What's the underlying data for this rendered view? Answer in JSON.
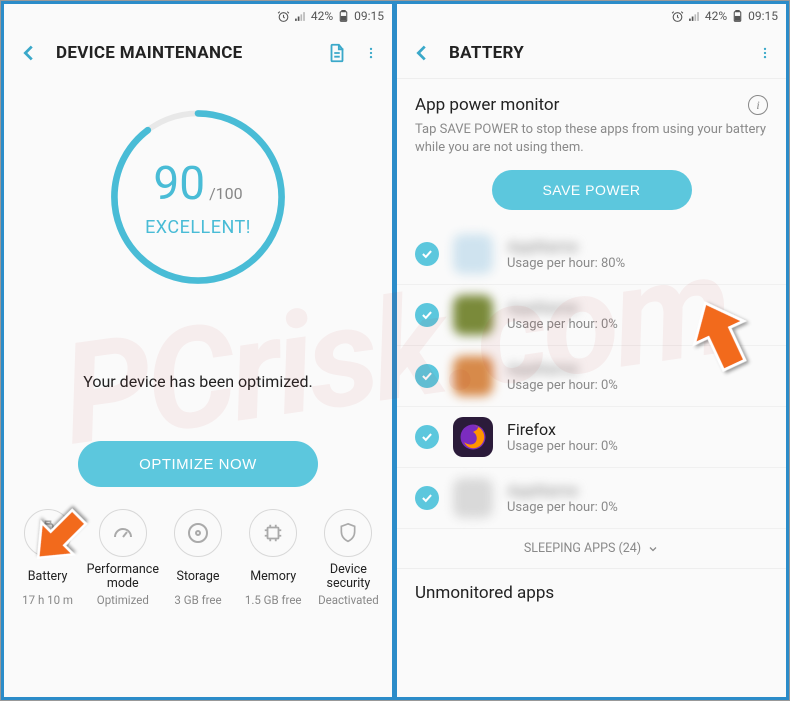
{
  "status": {
    "battery_pct": "42%",
    "time": "09:15"
  },
  "left": {
    "title": "DEVICE MAINTENANCE",
    "score": "90",
    "score_max": "/100",
    "score_word": "EXCELLENT!",
    "optimized_msg": "Your device has been optimized.",
    "optimize_btn": "OPTIMIZE NOW",
    "cats": [
      {
        "label": "Battery",
        "sub": "17 h 10 m"
      },
      {
        "label": "Performance mode",
        "sub": "Optimized"
      },
      {
        "label": "Storage",
        "sub": "3 GB free"
      },
      {
        "label": "Memory",
        "sub": "1.5 GB free"
      },
      {
        "label": "Device security",
        "sub": "Deactivated"
      }
    ]
  },
  "right": {
    "title": "BATTERY",
    "section_title": "App power monitor",
    "section_sub": "Tap SAVE POWER to stop these apps from using your battery while you are not using them.",
    "save_btn": "SAVE POWER",
    "apps": [
      {
        "name": "",
        "usage": "Usage per hour: 80%",
        "blurred": true,
        "bg": "#cfe3ef"
      },
      {
        "name": "",
        "usage": "Usage per hour: 0%",
        "blurred": true,
        "bg": "#7a8a3a"
      },
      {
        "name": "",
        "usage": "Usage per hour: 0%",
        "blurred": true,
        "bg": "#d78a4a"
      },
      {
        "name": "Firefox",
        "usage": "Usage per hour: 0%",
        "blurred": false,
        "bg": "#2b1b3a"
      },
      {
        "name": "",
        "usage": "Usage per hour: 0%",
        "blurred": true,
        "bg": "#d9d9d9"
      }
    ],
    "sleeping": "SLEEPING APPS (24)",
    "unmonitored": "Unmonitored apps"
  },
  "watermark": "PCrisk.com"
}
